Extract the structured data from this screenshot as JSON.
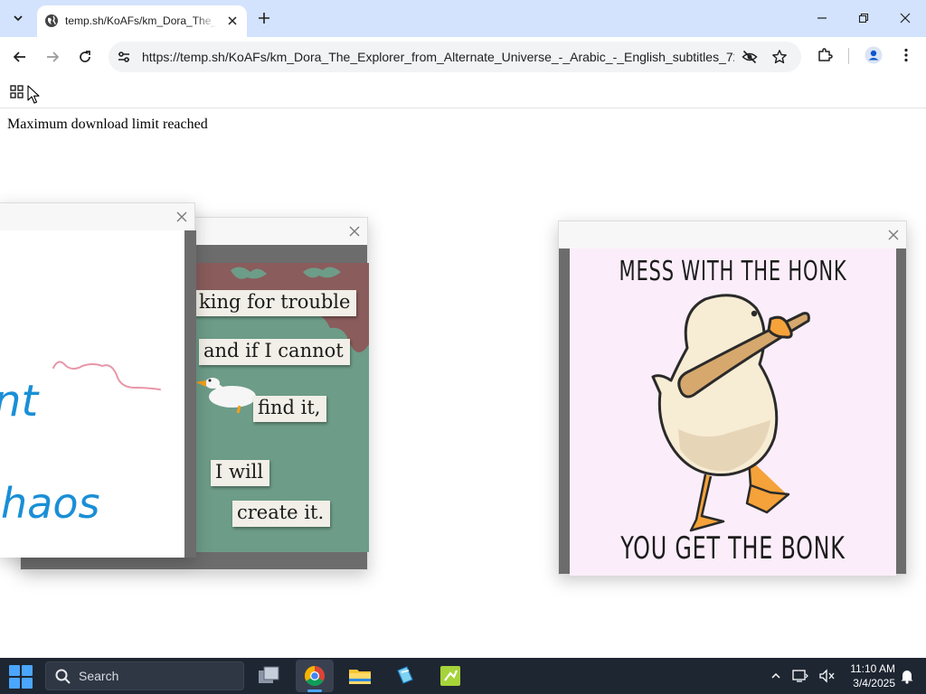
{
  "browser": {
    "tab": {
      "title": "temp.sh/KoAFs/km_Dora_The_Explorer_from_Alternate_Universe"
    },
    "address_bar": {
      "url": "https://temp.sh/KoAFs/km_Dora_The_Explorer_from_Alternate_Universe_-_Arabic_-_English_subtitles_72..."
    },
    "icons": {
      "tab_search": "chevron-down-icon",
      "favicon": "globe-icon",
      "tab_close": "close-icon",
      "new_tab": "plus-icon",
      "back": "back-arrow-icon",
      "forward": "forward-arrow-icon",
      "reload": "reload-icon",
      "site_info": "tune-icon",
      "eye_off": "eye-off-icon",
      "bookmark": "star-icon",
      "extensions": "puzzle-icon",
      "profile": "profile-icon",
      "menu": "more-vert-icon",
      "apps": "apps-grid-icon"
    }
  },
  "page": {
    "message": "Maximum download limit reached"
  },
  "popups": {
    "left": {
      "drawing_text": [
        "nt",
        "haos"
      ]
    },
    "middle": {
      "words": [
        "king for trouble",
        "and if I cannot",
        "find it,",
        "I will",
        "create it."
      ]
    },
    "right": {
      "top_caption": "MESS WITH THE HONK",
      "bottom_caption": "YOU GET THE BONK"
    }
  },
  "taskbar": {
    "search_label": "Search",
    "time": "11:10 AM",
    "date": "3/4/2025",
    "accent_color": "#4aa6ff"
  }
}
